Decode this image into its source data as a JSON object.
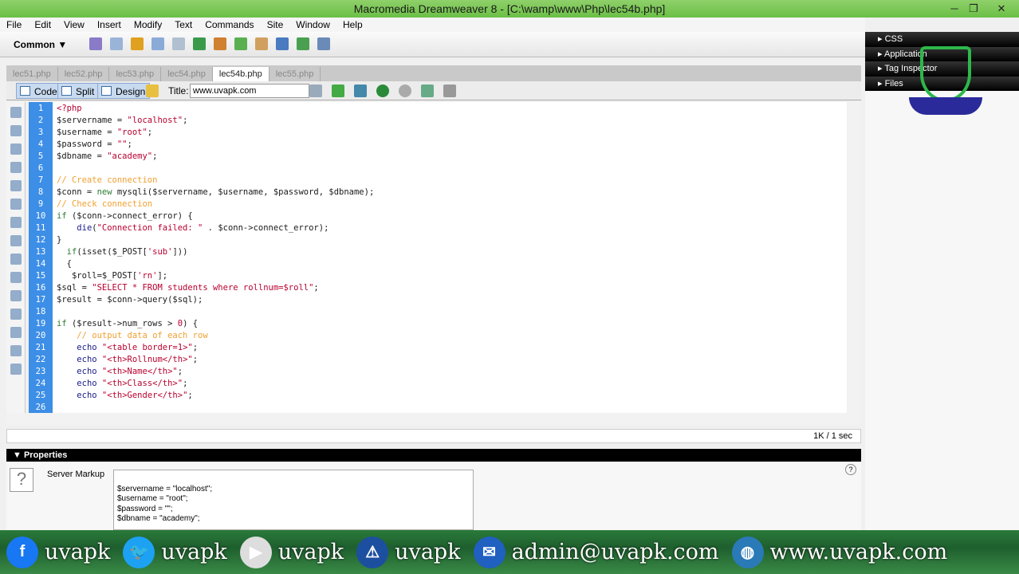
{
  "window": {
    "title": "Macromedia Dreamweaver 8 - [C:\\wamp\\www\\Php\\lec54b.php]",
    "min": "─",
    "max": "❐",
    "close": "✕"
  },
  "menu": [
    "File",
    "Edit",
    "View",
    "Insert",
    "Modify",
    "Text",
    "Commands",
    "Site",
    "Window",
    "Help"
  ],
  "insertbar": {
    "category": "Common"
  },
  "doctabs": [
    {
      "label": "lec51.php"
    },
    {
      "label": "lec52.php"
    },
    {
      "label": "lec53.php"
    },
    {
      "label": "lec54.php"
    },
    {
      "label": "lec54b.php",
      "active": true
    },
    {
      "label": "lec55.php"
    }
  ],
  "doctoolbar": {
    "code": "Code",
    "split": "Split",
    "design": "Design",
    "title_label": "Title:",
    "title_value": "www.uvapk.com"
  },
  "editor": {
    "lines": [
      [
        [
          "<?php",
          "s"
        ]
      ],
      [
        [
          "$servername = ",
          "v"
        ],
        [
          "\"localhost\"",
          "s"
        ],
        [
          ";",
          "v"
        ]
      ],
      [
        [
          "$username = ",
          "v"
        ],
        [
          "\"root\"",
          "s"
        ],
        [
          ";",
          "v"
        ]
      ],
      [
        [
          "$password = ",
          "v"
        ],
        [
          "\"\"",
          "s"
        ],
        [
          ";",
          "v"
        ]
      ],
      [
        [
          "$dbname = ",
          "v"
        ],
        [
          "\"academy\"",
          "s"
        ],
        [
          ";",
          "v"
        ]
      ],
      [],
      [
        [
          "// Create connection",
          "c"
        ]
      ],
      [
        [
          "$conn = ",
          "v"
        ],
        [
          "new",
          "k"
        ],
        [
          " mysqli($servername, $username, $password, $dbname);",
          "v"
        ]
      ],
      [
        [
          "// Check connection",
          "c"
        ]
      ],
      [
        [
          "if",
          "k"
        ],
        [
          " ($conn->connect_error) {",
          "v"
        ]
      ],
      [
        [
          "    ",
          "v"
        ],
        [
          "die",
          "f"
        ],
        [
          "(",
          "v"
        ],
        [
          "\"Connection failed: \"",
          "s"
        ],
        [
          " . $conn->connect_error);",
          "v"
        ]
      ],
      [
        [
          "}",
          "v"
        ]
      ],
      [
        [
          "  ",
          "v"
        ],
        [
          "if",
          "k"
        ],
        [
          "(isset($_POST[",
          "v"
        ],
        [
          "'sub'",
          "s"
        ],
        [
          "]))",
          "v"
        ]
      ],
      [
        [
          "  {",
          "v"
        ]
      ],
      [
        [
          "   $roll=$_POST[",
          "v"
        ],
        [
          "'rn'",
          "s"
        ],
        [
          "];",
          "v"
        ]
      ],
      [
        [
          "$sql = ",
          "v"
        ],
        [
          "\"SELECT * FROM students where rollnum=$roll\"",
          "s"
        ],
        [
          ";",
          "v"
        ]
      ],
      [
        [
          "$result = $conn->query($sql);",
          "v"
        ]
      ],
      [],
      [
        [
          "if",
          "k"
        ],
        [
          " ($result->num_rows > ",
          "v"
        ],
        [
          "0",
          "s"
        ],
        [
          ") {",
          "v"
        ]
      ],
      [
        [
          "    // output data of each row",
          "c"
        ]
      ],
      [
        [
          "    ",
          "v"
        ],
        [
          "echo",
          "f"
        ],
        [
          " ",
          "v"
        ],
        [
          "\"<table border=1>\"",
          "s"
        ],
        [
          ";",
          "v"
        ]
      ],
      [
        [
          "    ",
          "v"
        ],
        [
          "echo",
          "f"
        ],
        [
          " ",
          "v"
        ],
        [
          "\"<th>Rollnum</th>\"",
          "s"
        ],
        [
          ";",
          "v"
        ]
      ],
      [
        [
          "    ",
          "v"
        ],
        [
          "echo",
          "f"
        ],
        [
          " ",
          "v"
        ],
        [
          "\"<th>Name</th>\"",
          "s"
        ],
        [
          ";",
          "v"
        ]
      ],
      [
        [
          "    ",
          "v"
        ],
        [
          "echo",
          "f"
        ],
        [
          " ",
          "v"
        ],
        [
          "\"<th>Class</th>\"",
          "s"
        ],
        [
          ";",
          "v"
        ]
      ],
      [
        [
          "    ",
          "v"
        ],
        [
          "echo",
          "f"
        ],
        [
          " ",
          "v"
        ],
        [
          "\"<th>Gender</th>\"",
          "s"
        ],
        [
          ";",
          "v"
        ]
      ],
      []
    ]
  },
  "status": {
    "size": "1K / 1 sec"
  },
  "properties": {
    "header": "Properties",
    "label": "Server Markup",
    "markup": [
      "$servername = \"localhost\";",
      "$username = \"root\";",
      "$password = \"\";",
      "$dbname = \"academy\";"
    ]
  },
  "panels": [
    "CSS",
    "Application",
    "Tag Inspector",
    "Files"
  ],
  "banner": [
    {
      "icon": "facebook-icon",
      "text": "uvapk",
      "color": "#1877f2"
    },
    {
      "icon": "twitter-icon",
      "text": "uvapk",
      "color": "#1da1f2"
    },
    {
      "icon": "youtube-icon",
      "text": "uvapk",
      "color": "#ddd"
    },
    {
      "icon": "warning-icon",
      "text": "uvapk",
      "color": "#1d4fa0"
    },
    {
      "icon": "email-icon",
      "text": "admin@uvapk.com",
      "color": "#2060c0"
    },
    {
      "icon": "globe-icon",
      "text": "www.uvapk.com",
      "color": "#2a7ab8"
    }
  ]
}
